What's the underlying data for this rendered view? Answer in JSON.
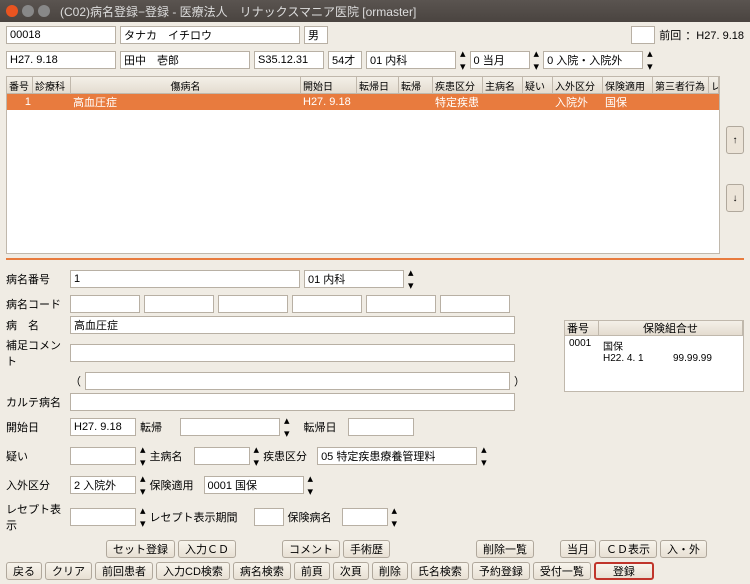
{
  "title": "(C02)病名登録−登録 - 医療法人　リナックスマニア医院 [ormaster]",
  "top": {
    "patient_id": "00018",
    "kana": "タナカ　イチロウ",
    "sex": "男",
    "prev_label": "前回",
    "prev_date": "：H27. 9.18",
    "date1": "H27. 9.18",
    "name": "田中　壱郎",
    "birth": "S35.12.31",
    "age": "54才",
    "dept": "01 内科",
    "month_code": "0 当月",
    "inout": "0 入院・入院外"
  },
  "cols": [
    "番号",
    "診療科",
    "傷病名",
    "開始日",
    "転帰日",
    "転帰",
    "疾患区分",
    "主病名",
    "疑い",
    "入外区分",
    "保険適用",
    "第三者行為",
    "レ"
  ],
  "row1": {
    "no": "1",
    "dept": "",
    "name": "高血圧症",
    "start": "H27. 9.18",
    "enddate": "",
    "end": "",
    "disease": "特定疾患",
    "main": "",
    "doubt": "",
    "inout": "入院外",
    "ins": "国保"
  },
  "form": {
    "no_label": "病名番号",
    "no": "1",
    "dept": "01 内科",
    "code_label": "病名コード",
    "name_label": "病　名",
    "name": "高血圧症",
    "supp_label": "補足コメント",
    "paren_l": "（",
    "paren_r": "）",
    "karte_label": "カルテ病名",
    "start_label": "開始日",
    "start": "H27. 9.18",
    "tenki_label": "転帰",
    "tenki_date_label": "転帰日",
    "doubt_label": "疑い",
    "main_label": "主病名",
    "dk_label": "疾患区分",
    "dk": "05 特定疾患療養管理料",
    "inout_label": "入外区分",
    "inout": "2 入院外",
    "ins_label": "保険適用",
    "ins": "0001 国保",
    "receipt_label": "レセプト表示",
    "receipt_period_label": "レセプト表示期間",
    "ins_name_label": "保険病名"
  },
  "combo": {
    "h1": "番号",
    "h2": "保険組合せ",
    "r1": "0001",
    "r2": "国保",
    "r3": "H22. 4. 1",
    "r4": "99.99.99"
  },
  "btns": {
    "set": "セット登録",
    "cd": "入力ＣＤ",
    "comment": "コメント",
    "ope": "手術歴",
    "dellist": "削除一覧",
    "cur": "当月",
    "cddisp": "ＣＤ表示",
    "io": "入・外",
    "back": "戻る",
    "clear": "クリア",
    "prevpat": "前回患者",
    "cdsearch": "入力CD検索",
    "namesearch": "病名検索",
    "prev": "前頁",
    "next": "次頁",
    "del": "削除",
    "ns": "氏名検索",
    "yoyaku": "予約登録",
    "uketsuke": "受付一覧",
    "reg": "登録"
  }
}
